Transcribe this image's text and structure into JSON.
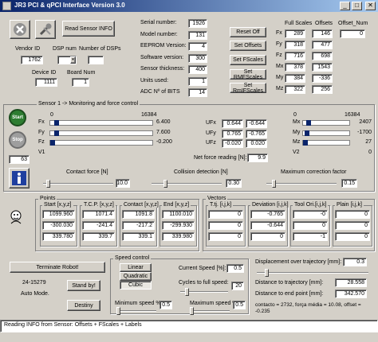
{
  "app": {
    "title": "JR3 PCI & qPCI Interface Version 3.0",
    "minimize": "_",
    "maximize": "□",
    "close": "✕"
  },
  "toolbar": {
    "read_sensor_info": "Read Sensor INFO",
    "vendor_id_label": "Vendor ID",
    "vendor_id": "1762",
    "dsp_num_label": "DSP num",
    "dsp_num": "0",
    "num_dsps_label": "Number of DSPs",
    "num_dsps": "",
    "device_id_label": "Device ID",
    "device_id": "1111",
    "board_num_label": "Board Num",
    "board_num": "1"
  },
  "info": {
    "items": [
      {
        "label": "Serial number:",
        "value": "1926"
      },
      {
        "label": "Model number:",
        "value": "131"
      },
      {
        "label": "EEPROM Version:",
        "value": "4"
      },
      {
        "label": "Software version:",
        "value": "300"
      },
      {
        "label": "Sensor thickness:",
        "value": "400"
      },
      {
        "label": "Units used:",
        "value": "1"
      },
      {
        "label": "ADC Nº of BITS",
        "value": "14"
      }
    ]
  },
  "buttons": {
    "reset_off": "Reset Off",
    "set_offsets": "Set Offsets",
    "set_fscales": "Set FScales",
    "set_rmfscales": "Set RMFScales",
    "set_rmifscales": "Set RmIFScales",
    "terminate": "Terminate Robot!",
    "stand_by": "Stand by!",
    "destiny": "Destiny",
    "start": "Start",
    "stop": "Stop"
  },
  "scales": {
    "col_full": "Full Scales",
    "col_offsets": "Offsets",
    "col_offset_num": "Offset_Num",
    "offset_num": "0",
    "rows": [
      {
        "axis": "Fx",
        "full": "289",
        "offset": "146"
      },
      {
        "axis": "Fy",
        "full": "318",
        "offset": "477"
      },
      {
        "axis": "Fz",
        "full": "716",
        "offset": "698"
      },
      {
        "axis": "Mx",
        "full": "378",
        "offset": "1543"
      },
      {
        "axis": "My",
        "full": "384",
        "offset": "-336"
      },
      {
        "axis": "Mz",
        "full": "322",
        "offset": "256"
      }
    ]
  },
  "sensor": {
    "title": "Sensor 1 -> Monitoring and force control",
    "range_min": "0",
    "range_max": "16384",
    "side_value": "63",
    "forces": [
      {
        "axis": "Fx",
        "value": "6.400",
        "level": 0.04
      },
      {
        "axis": "Fy",
        "value": "7.600",
        "level": 0.04
      },
      {
        "axis": "Fz",
        "value": "-0.200",
        "level": 0.0
      },
      {
        "axis": "V1",
        "value": "",
        "level": 0.0
      }
    ],
    "uf": [
      {
        "label": "UFx",
        "a": "0.644",
        "b": "-0.644"
      },
      {
        "label": "UFy",
        "a": "0.765",
        "b": "-0.765"
      },
      {
        "label": "UFz",
        "a": "-0.020",
        "b": "0.020"
      }
    ],
    "net_force_label": "Net force reading [N]:",
    "net_force": "9.9",
    "moments": [
      {
        "axis": "Mx",
        "value": "2407",
        "level": 0.07
      },
      {
        "axis": "My",
        "value": "-1700",
        "level": 0.04
      },
      {
        "axis": "Mz",
        "value": "27",
        "level": 0.0
      },
      {
        "axis": "V2",
        "value": "0",
        "level": 0.0
      }
    ],
    "contact_label": "Contact force [N]",
    "contact": "10.0",
    "contact_level": 0.05,
    "collision_label": "Collision detection [N]",
    "collision": "0.30",
    "collision_level": 0.18,
    "correction_label": "Maximum correction factor",
    "correction": "0.15",
    "correction_level": 0.08
  },
  "points": {
    "title": "Points",
    "cols": [
      "Start [x,y,z]",
      "T.C.P. [x,y,z]",
      "Contact [x,y,z]",
      "End [x,y,z]"
    ],
    "rows": [
      [
        "1099.960",
        "1071.4",
        "1091.8",
        "1100.010"
      ],
      [
        "-300.030",
        "-241.4",
        "-217.2",
        "-299.930"
      ],
      [
        "339.780",
        "339.7",
        "339.1",
        "339.980"
      ]
    ]
  },
  "vectors": {
    "title": "Vectors",
    "cols": [
      "T.tj. [i,j,k]",
      "Deviation [i,j,k]",
      "Tool Ori.[i,j,k]",
      "Plain [i,j,k]"
    ],
    "rows": [
      [
        "0",
        "-0.765",
        "-0",
        "0"
      ],
      [
        "0",
        "-0.644",
        "0",
        "0"
      ],
      [
        "0",
        "0",
        "-1",
        "0"
      ]
    ]
  },
  "bottom": {
    "robot_id": "24-15279",
    "mode": "Auto Mode.",
    "speed_title": "Speed control",
    "speed_options": [
      "Linear",
      "Quadratic",
      "Cubic"
    ],
    "speed_selected": "Cubic",
    "current_speed_label": "Current Speed [%]:",
    "current_speed": "0.5",
    "cycles_label": "Cycles to full speed:",
    "cycles": "20",
    "min_speed_label": "Minimum speed %",
    "min_speed": "0.5",
    "max_speed_label": "Maximum speed %",
    "max_speed": "0.5",
    "disp_label": "Displacement over trajectory [mm]:",
    "disp": "0.3",
    "dist_traj_label": "Distance to trajectory [mm]:",
    "dist_traj": "28.558",
    "dist_end_label": "Distance to end point [mm]:",
    "dist_end": "342.570",
    "contact_msg": "contacto = 2732, força média = 10.08, offset = -0.235"
  },
  "status": "Reading INFO from Sensor: Offsets + FScales + Labels",
  "colors": {
    "title_start": "#0a246a",
    "title_end": "#a6caf0",
    "start_green": "#2e7d32",
    "info_blue": "#1f3f9f"
  }
}
